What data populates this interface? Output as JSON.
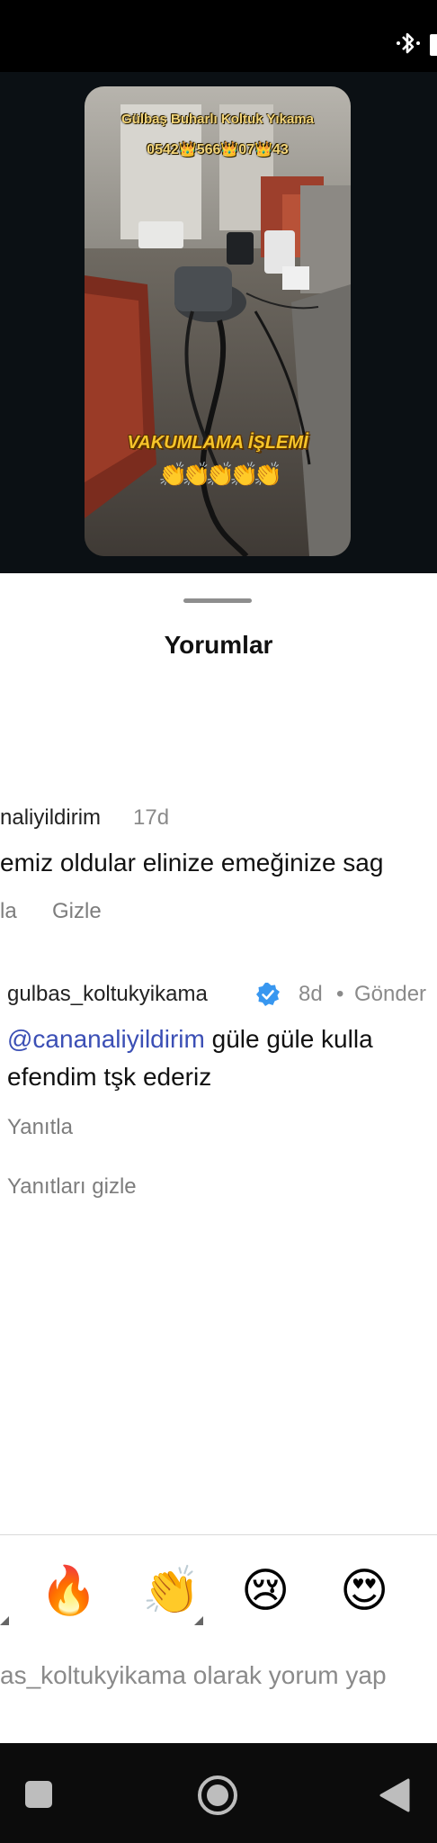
{
  "video": {
    "overlay_title": "Gülbaş Buharlı Koltuk Yıkama",
    "overlay_phone": "0542👑566👑07👑43",
    "overlay_caption": "VAKUMLAMA İŞLEMİ",
    "overlay_emojis": "👏👏👏👏👏"
  },
  "sheet": {
    "title": "Yorumlar"
  },
  "comment": {
    "username": "naliyildirim",
    "time": "17d",
    "text": "emiz oldular elinize emeğinize sag",
    "reply_action": "la",
    "hide_action": "Gizle"
  },
  "reply": {
    "username": "gulbas_koltukyikama",
    "time": "8d",
    "separator": "•",
    "status": "Gönder",
    "mention": "@cananaliyildirim",
    "text_line1": " güle güle kulla",
    "text_line2": "efendim tşk ederiz",
    "reply_action": "Yanıtla",
    "hide_replies": "Yanıtları gizle"
  },
  "reactions": [
    "🔥",
    "👏",
    "😢",
    "😍"
  ],
  "input": {
    "placeholder": "as_koltukyikama olarak yorum yap"
  },
  "colors": {
    "mention": "#3b4fb5",
    "verified": "#3897f0",
    "muted": "#8a8a8a"
  }
}
